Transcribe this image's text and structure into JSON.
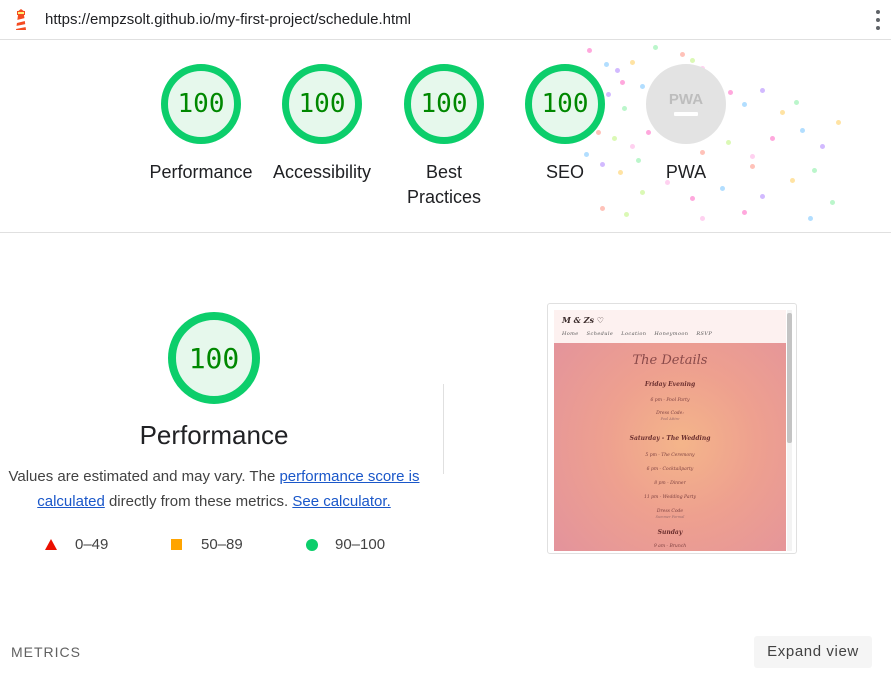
{
  "browser": {
    "url": "https://empzsolt.github.io/my-first-project/schedule.html",
    "logo_icon": "lighthouse-icon",
    "menu_icon": "more-vert-icon"
  },
  "scores": [
    {
      "label": "Performance",
      "value": "100"
    },
    {
      "label": "Accessibility",
      "value": "100"
    },
    {
      "label": "Best Practices",
      "value": "100"
    },
    {
      "label": "SEO",
      "value": "100"
    },
    {
      "label": "PWA",
      "badge": "PWA"
    }
  ],
  "performance": {
    "score": "100",
    "title": "Performance",
    "desc_prefix": "Values are estimated and may vary. The ",
    "link_score": "performance score is calculated",
    "desc_middle": " directly from these metrics. ",
    "link_calc": "See calculator.",
    "legend": [
      {
        "icon": "fail-triangle-icon",
        "range": "0–49",
        "color": "#eb0f00"
      },
      {
        "icon": "average-square-icon",
        "range": "50–89",
        "color": "#ffa400"
      },
      {
        "icon": "pass-circle-icon",
        "range": "90–100",
        "color": "#0cce6b"
      }
    ]
  },
  "thumbnail": {
    "brand": "M & Zs ♡",
    "nav": [
      "Home",
      "Schedule",
      "Location",
      "Honeymoon",
      "RSVP"
    ],
    "title": "The Details",
    "lines": [
      {
        "text": "Friday Evening",
        "style": "h"
      },
      {
        "text": "6 pm - Pool Party",
        "style": "s"
      },
      {
        "text": "Dress Code:",
        "style": "s"
      },
      {
        "text": "Pool Attire",
        "style": "xs"
      },
      {
        "text": "Saturday - The Wedding",
        "style": "h"
      },
      {
        "text": "5 pm - The Ceremony",
        "style": "s"
      },
      {
        "text": "6 pm - Cocktailparty",
        "style": "s"
      },
      {
        "text": "8 pm - Dinner",
        "style": "s"
      },
      {
        "text": "11 pm - Wedding Party",
        "style": "s"
      },
      {
        "text": "Dress Code",
        "style": "s"
      },
      {
        "text": "Summer Formal",
        "style": "xs"
      },
      {
        "text": "Sunday",
        "style": "h"
      },
      {
        "text": "9 am - Brunch",
        "style": "s"
      }
    ]
  },
  "footer": {
    "metrics_label": "METRICS",
    "expand_label": "Expand view"
  },
  "colors": {
    "pass": "#0cce6b",
    "pass_text": "#008800",
    "pass_bg": "#e6f8ec",
    "link": "#1a57c9"
  }
}
